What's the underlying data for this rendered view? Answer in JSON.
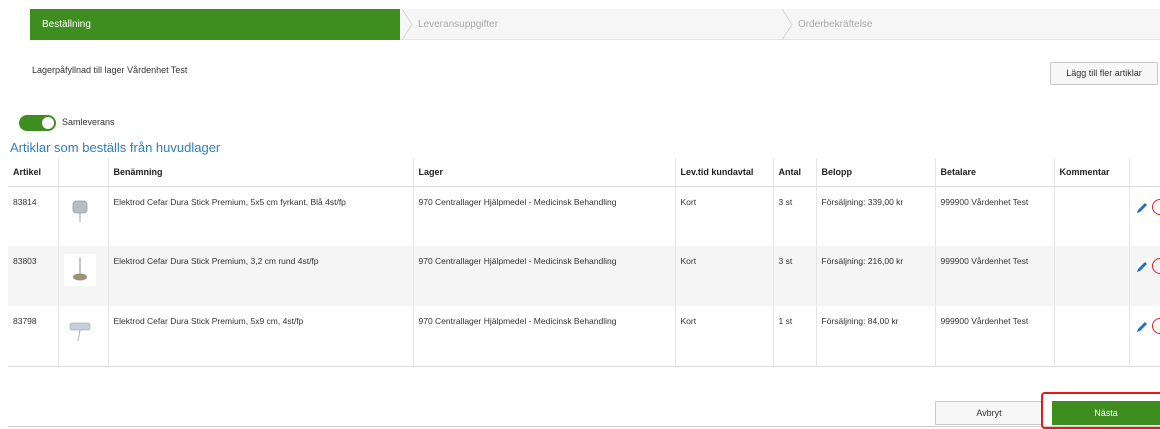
{
  "steps": [
    {
      "label": "Beställning",
      "active": true
    },
    {
      "label": "Leveransuppgifter",
      "active": false
    },
    {
      "label": "Orderbekräftelse",
      "active": false
    }
  ],
  "info_text": "Lagerpåfyllnad till lager Vårdenhet Test",
  "add_button": "Lägg till fler artiklar",
  "toggle": {
    "label": "Samleverans",
    "on": true
  },
  "section_title": "Artiklar som beställs från huvudlager",
  "table": {
    "headers": [
      "Artikel",
      "",
      "Benämning",
      "Lager",
      "Lev.tid kundavtal",
      "Antal",
      "Belopp",
      "Betalare",
      "Kommentar",
      ""
    ],
    "rows": [
      {
        "artikel": "83814",
        "benamning": "Elektrod Cefar Dura Stick Premium, 5x5 cm fyrkant, Blå 4st/fp",
        "lager": "970 Centrallager Hjälpmedel - Medicinsk Behandling",
        "levtid": "Kort",
        "antal": "3 st",
        "belopp": "Försäljning: 339,00 kr",
        "betalare": "999900 Vårdenhet Test",
        "kommentar": ""
      },
      {
        "artikel": "83803",
        "benamning": "Elektrod Cefar Dura Stick Premium, 3,2 cm rund 4st/fp",
        "lager": "970 Centrallager Hjälpmedel - Medicinsk Behandling",
        "levtid": "Kort",
        "antal": "3 st",
        "belopp": "Försäljning: 216,00 kr",
        "betalare": "999900 Vårdenhet Test",
        "kommentar": ""
      },
      {
        "artikel": "83798",
        "benamning": "Elektrod Cefar Dura Stick Premium, 5x9 cm, 4st/fp",
        "lager": "970 Centrallager Hjälpmedel - Medicinsk Behandling",
        "levtid": "Kort",
        "antal": "1 st",
        "belopp": "Försäljning: 84,00 kr",
        "betalare": "999900 Vårdenhet Test",
        "kommentar": ""
      }
    ]
  },
  "buttons": {
    "cancel": "Avbryt",
    "next": "Nästa"
  },
  "icons": {
    "edit": "pencil-icon",
    "remove": "remove-circle-icon"
  },
  "colors": {
    "accent": "#3e8e1f",
    "link": "#2d7fbf",
    "highlight": "#e41b1b"
  }
}
